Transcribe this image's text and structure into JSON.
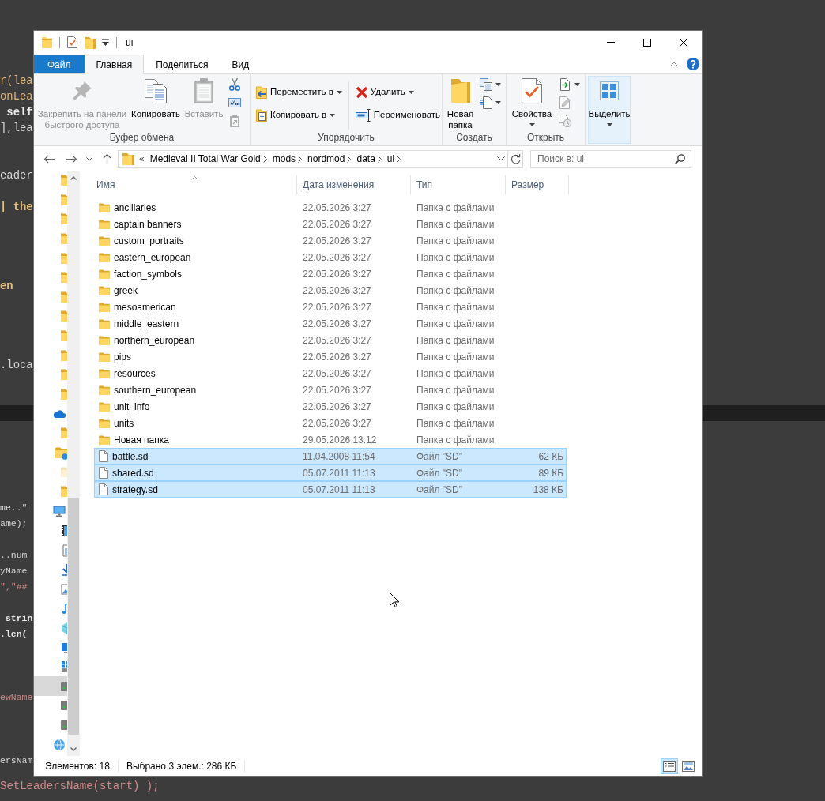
{
  "background_code": {
    "upper_lines": [
      {
        "text": "r(lea",
        "kind": "call"
      },
      {
        "text": "onLea",
        "kind": "call"
      },
      {
        "text": " self",
        "kind": "bold"
      },
      {
        "text": "],lea",
        "kind": "plain"
      },
      {
        "text": "eader",
        "kind": "plain"
      },
      {
        "text": "| the",
        "kind": "keyword"
      },
      {
        "text": "en",
        "kind": "keyword"
      },
      {
        "text": ".loca",
        "kind": "plain"
      }
    ],
    "lower_lines": [
      {
        "text": "me..\"",
        "kind": "plain"
      },
      {
        "text": "ame);",
        "kind": "plain"
      },
      {
        "text": "..num",
        "kind": "plain"
      },
      {
        "text": "yName",
        "kind": "plain"
      },
      {
        "text": "\",\"##",
        "kind": "string"
      },
      {
        "text": " strin",
        "kind": "bold"
      },
      {
        "text": ".len(",
        "kind": "bold"
      },
      {
        "text": "ewName",
        "kind": "string"
      },
      {
        "text": "ersNam",
        "kind": "plain"
      }
    ],
    "bottom_line": {
      "text": "SetLeadersName(start) );",
      "kind": "string"
    }
  },
  "window": {
    "title": "ui"
  },
  "ribbon": {
    "tabs": [
      {
        "label": "Файл",
        "kind": "file",
        "selected": false
      },
      {
        "label": "Главная",
        "kind": "tab",
        "selected": true
      },
      {
        "label": "Поделиться",
        "kind": "tab",
        "selected": false
      },
      {
        "label": "Вид",
        "kind": "tab",
        "selected": false
      }
    ],
    "groups": [
      {
        "label": "Буфер обмена",
        "items": [
          {
            "label": "Закрепить на панели\nбыстрого доступа",
            "dropdown": false,
            "disabled": true,
            "highlighted": false
          },
          {
            "label": "Копировать",
            "dropdown": false,
            "disabled": false,
            "highlighted": false
          },
          {
            "label": "Вставить",
            "dropdown": false,
            "disabled": true,
            "highlighted": false
          },
          {
            "dropdown": false,
            "disabled": false,
            "highlighted": false
          },
          {
            "dropdown": false,
            "disabled": false,
            "highlighted": false
          },
          {
            "dropdown": false,
            "disabled": true,
            "highlighted": false
          }
        ]
      },
      {
        "label": "Упорядочить",
        "items": [
          {
            "label": "Переместить в",
            "dropdown": true,
            "disabled": false,
            "highlighted": false
          },
          {
            "label": "Копировать в",
            "dropdown": true,
            "disabled": false,
            "highlighted": false
          },
          {
            "label": "Удалить",
            "dropdown": true,
            "disabled": false,
            "highlighted": false
          },
          {
            "label": "Переименовать",
            "dropdown": false,
            "disabled": false,
            "highlighted": false
          }
        ]
      },
      {
        "label": "Создать",
        "items": [
          {
            "label": "Новая\nпапка",
            "dropdown": false,
            "disabled": false,
            "highlighted": false
          },
          {
            "dropdown": true,
            "disabled": false,
            "highlighted": false
          },
          {
            "dropdown": true,
            "disabled": false,
            "highlighted": false
          }
        ]
      },
      {
        "label": "Открыть",
        "items": [
          {
            "label": "Свойства",
            "dropdown": true,
            "disabled": false,
            "highlighted": false
          },
          {
            "dropdown": true,
            "disabled": false,
            "highlighted": false
          },
          {
            "dropdown": false,
            "disabled": true,
            "highlighted": false
          },
          {
            "dropdown": false,
            "disabled": true,
            "highlighted": false
          }
        ]
      },
      {
        "items": [
          {
            "label": "Выделить",
            "dropdown": true,
            "disabled": false,
            "highlighted": true
          }
        ]
      }
    ]
  },
  "address_bar": {
    "overflow": "«",
    "path": [
      "Medieval II Total War Gold",
      "mods",
      "nordmod",
      "data",
      "ui"
    ]
  },
  "search": {
    "placeholder": "Поиск в: ui"
  },
  "nav_pane": {
    "items": [
      {
        "kind": "folder",
        "selected": false
      },
      {
        "kind": "folder",
        "selected": false
      },
      {
        "kind": "folder",
        "selected": false
      },
      {
        "kind": "folder",
        "selected": false
      },
      {
        "kind": "folder",
        "selected": false
      },
      {
        "kind": "folder",
        "selected": false
      },
      {
        "kind": "folder",
        "selected": false
      },
      {
        "kind": "folder",
        "selected": false
      },
      {
        "kind": "folder",
        "selected": false
      },
      {
        "kind": "folder",
        "selected": false
      },
      {
        "kind": "folder",
        "selected": false
      },
      {
        "kind": "folder",
        "selected": false
      },
      {
        "kind": "cloud",
        "selected": false,
        "children": [
          {
            "kind": "folder",
            "selected": false
          }
        ]
      },
      {
        "kind": "user_folder",
        "selected": false,
        "children": [
          {
            "kind": "hidden_folder",
            "selected": false
          },
          {
            "kind": "folder",
            "selected": false
          }
        ]
      },
      {
        "kind": "pc",
        "selected": false,
        "children": [
          {
            "kind": "videos",
            "selected": false
          },
          {
            "kind": "documents",
            "selected": false
          },
          {
            "kind": "downloads",
            "selected": false
          },
          {
            "kind": "pictures",
            "selected": false
          },
          {
            "kind": "music",
            "selected": false
          },
          {
            "kind": "objects3d",
            "selected": false
          },
          {
            "kind": "desktop",
            "selected": false
          },
          {
            "kind": "system_drive",
            "selected": false
          },
          {
            "kind": "drive",
            "selected": true
          },
          {
            "kind": "drive",
            "selected": false
          },
          {
            "kind": "drive",
            "selected": false
          }
        ]
      },
      {
        "kind": "network",
        "selected": false
      }
    ]
  },
  "file_list": {
    "columns": [
      {
        "label": "Имя",
        "sorted": true
      },
      {
        "label": "Дата изменения",
        "sorted": false
      },
      {
        "label": "Тип",
        "sorted": false
      },
      {
        "label": "Размер",
        "sorted": false
      }
    ],
    "rows": [
      {
        "kind": "folder",
        "name": "ancillaries",
        "date": "22.05.2026 3:27",
        "type": "Папка с файлами",
        "selected": false
      },
      {
        "kind": "folder",
        "name": "captain banners",
        "date": "22.05.2026 3:27",
        "type": "Папка с файлами",
        "selected": false
      },
      {
        "kind": "folder",
        "name": "custom_portraits",
        "date": "22.05.2026 3:27",
        "type": "Папка с файлами",
        "selected": false
      },
      {
        "kind": "folder",
        "name": "eastern_european",
        "date": "22.05.2026 3:27",
        "type": "Папка с файлами",
        "selected": false
      },
      {
        "kind": "folder",
        "name": "faction_symbols",
        "date": "22.05.2026 3:27",
        "type": "Папка с файлами",
        "selected": false
      },
      {
        "kind": "folder",
        "name": "greek",
        "date": "22.05.2026 3:27",
        "type": "Папка с файлами",
        "selected": false
      },
      {
        "kind": "folder",
        "name": "mesoamerican",
        "date": "22.05.2026 3:27",
        "type": "Папка с файлами",
        "selected": false
      },
      {
        "kind": "folder",
        "name": "middle_eastern",
        "date": "22.05.2026 3:27",
        "type": "Папка с файлами",
        "selected": false
      },
      {
        "kind": "folder",
        "name": "northern_european",
        "date": "22.05.2026 3:27",
        "type": "Папка с файлами",
        "selected": false
      },
      {
        "kind": "folder",
        "name": "pips",
        "date": "22.05.2026 3:27",
        "type": "Папка с файлами",
        "selected": false
      },
      {
        "kind": "folder",
        "name": "resources",
        "date": "22.05.2026 3:27",
        "type": "Папка с файлами",
        "selected": false
      },
      {
        "kind": "folder",
        "name": "southern_european",
        "date": "22.05.2026 3:27",
        "type": "Папка с файлами",
        "selected": false
      },
      {
        "kind": "folder",
        "name": "unit_info",
        "date": "22.05.2026 3:27",
        "type": "Папка с файлами",
        "selected": false
      },
      {
        "kind": "folder",
        "name": "units",
        "date": "22.05.2026 3:27",
        "type": "Папка с файлами",
        "selected": false
      },
      {
        "kind": "folder",
        "name": "Новая папка",
        "date": "29.05.2026 13:12",
        "type": "Папка с файлами",
        "selected": false
      },
      {
        "kind": "file",
        "name": "battle.sd",
        "date": "11.04.2008 11:54",
        "type": "Файл \"SD\"",
        "size": "62 КБ",
        "selected": true
      },
      {
        "kind": "file",
        "name": "shared.sd",
        "date": "05.07.2011 11:13",
        "type": "Файл \"SD\"",
        "size": "89 КБ",
        "selected": true
      },
      {
        "kind": "file",
        "name": "strategy.sd",
        "date": "05.07.2011 11:13",
        "type": "Файл \"SD\"",
        "size": "138 КБ",
        "selected": true
      }
    ]
  },
  "status_bar": {
    "item_count": "Элементов: 18",
    "selection": "Выбрано 3 элем.: 286 КБ",
    "views": [
      {
        "kind": "details",
        "selected": true
      },
      {
        "kind": "large_icons",
        "selected": false
      }
    ]
  }
}
